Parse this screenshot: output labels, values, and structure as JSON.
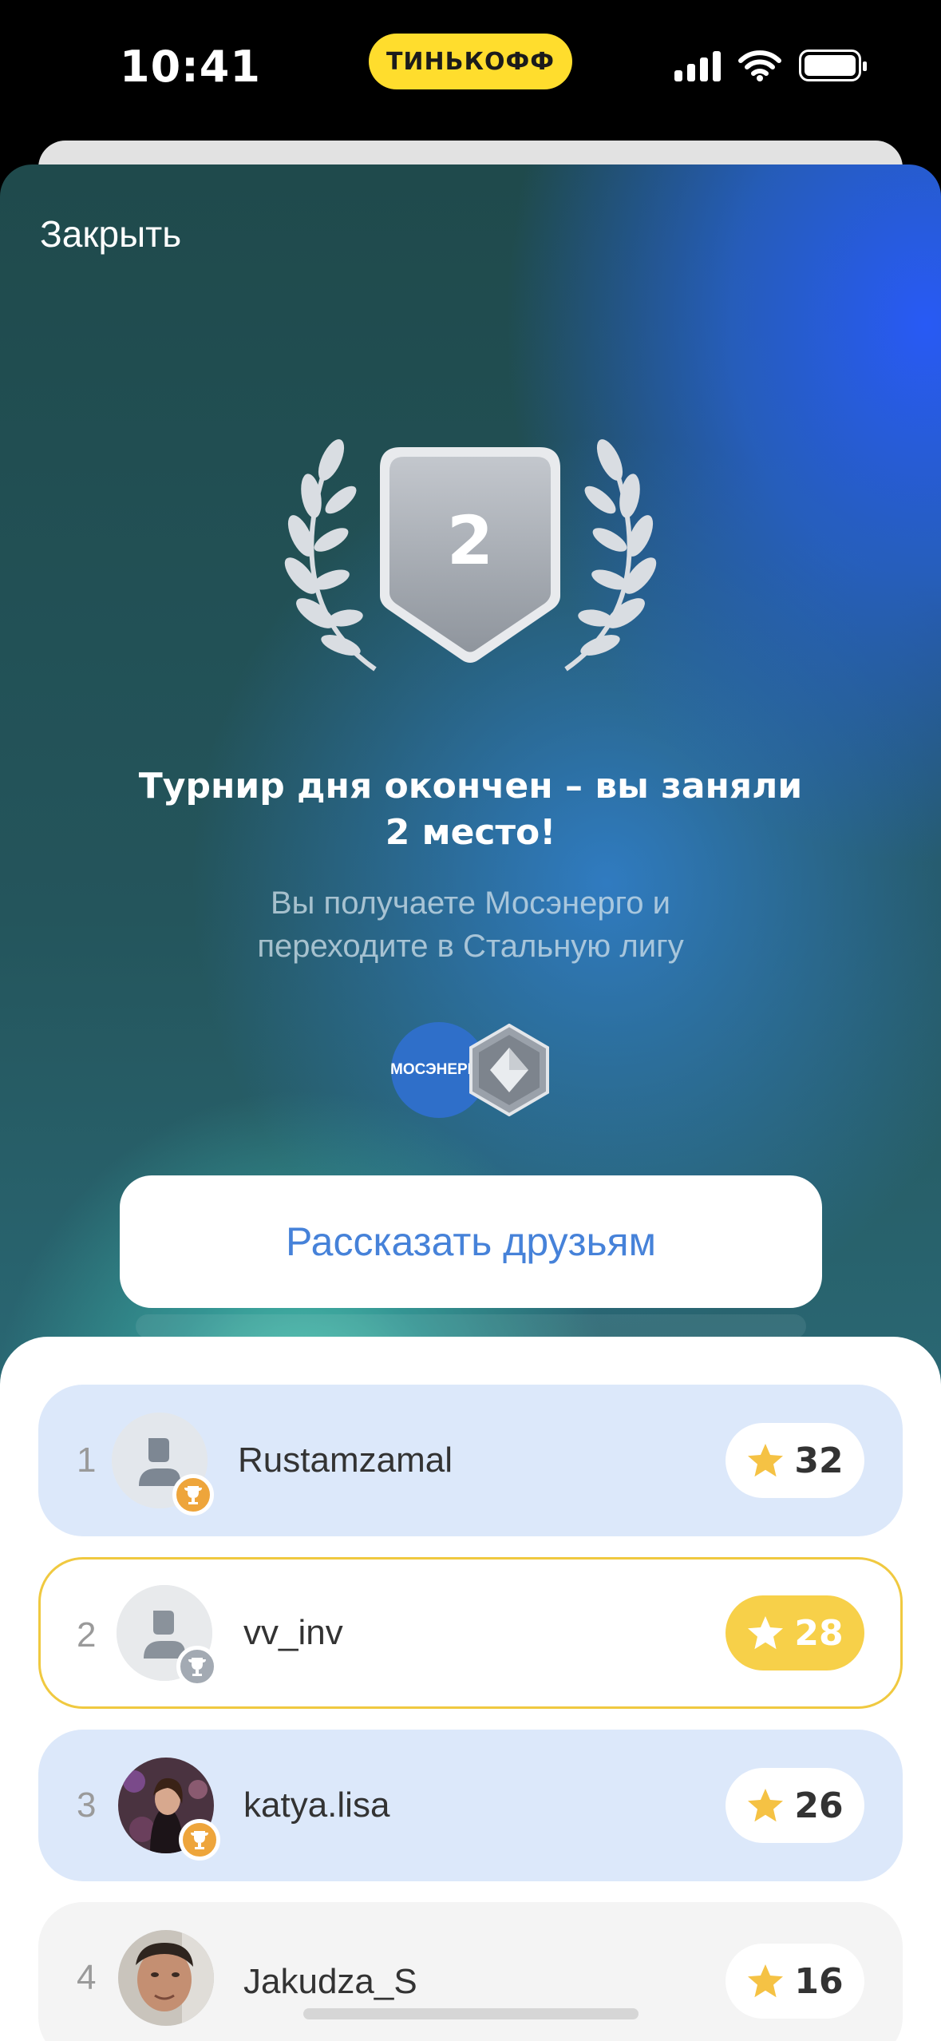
{
  "status_bar": {
    "time": "10:41",
    "carrier_pill": "ТИНЬКОФФ",
    "icons": [
      "cellular-signal-icon",
      "wifi-icon",
      "battery-icon"
    ]
  },
  "modal": {
    "close_label": "Закрыть",
    "place_badge_number": "2",
    "title_line1": "Турнир дня окончен – вы заняли",
    "title_line2": "2 место!",
    "subtitle_line1": "Вы получаете Мосэнерго и",
    "subtitle_line2": "переходите в Стальную лигу",
    "reward_logo_text": "МОСЭНЕРГО",
    "league_icon": "steel-league-icon",
    "share_button_label": "Рассказать друзьям"
  },
  "leaderboard": {
    "rows": [
      {
        "rank": "1",
        "username": "Rustamzamal",
        "score": "32",
        "trophy": "gold",
        "avatar": "placeholder"
      },
      {
        "rank": "2",
        "username": "vv_inv",
        "score": "28",
        "trophy": "silver",
        "avatar": "placeholder",
        "current_user": true
      },
      {
        "rank": "3",
        "username": "katya.lisa",
        "score": "26",
        "trophy": "gold",
        "avatar": "photo"
      },
      {
        "rank": "4",
        "username": "Jakudza_S",
        "score": "16",
        "avatar": "photo"
      }
    ]
  },
  "colors": {
    "accent_yellow": "#f7d049",
    "row_blue": "#dce8fa",
    "link_blue": "#4682d9",
    "brand_yellow": "#ffdd2d"
  }
}
